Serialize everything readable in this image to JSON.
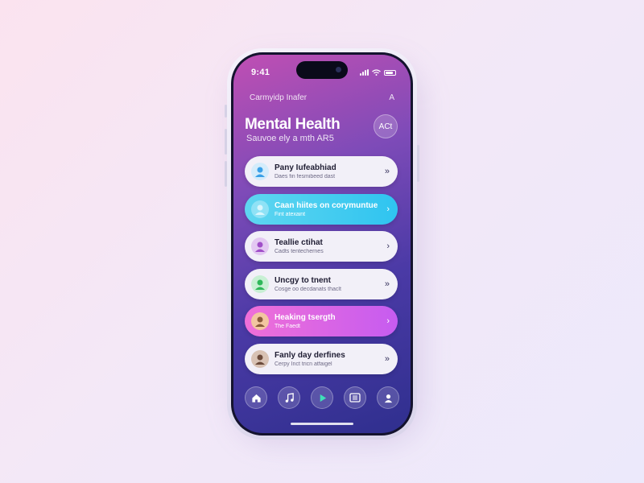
{
  "status_bar": {
    "time": "9:41"
  },
  "app": {
    "left_label": "Carmyidp Inafer",
    "right_label": "A",
    "title": "Mental Health",
    "subtitle": "Sauvoe ely a mth AR5",
    "action_label": "ACt"
  },
  "cards": [
    {
      "title": "Pany Iufeabhiad",
      "subtitle": "Daes fin fesmibeed dast",
      "style": "light",
      "avatar_color": "#3aa0e8",
      "avatar_icon": "person-icon"
    },
    {
      "title": "Caan hiites on corymuntue",
      "subtitle": "Fint atexaint",
      "style": "teal",
      "avatar_color": "#8fe2f6",
      "avatar_icon": "person-icon"
    },
    {
      "title": "Teallie ctihat",
      "subtitle": "Cadts tentechernes",
      "style": "light",
      "avatar_color": "#a04fc8",
      "avatar_icon": "person-icon"
    },
    {
      "title": "Uncgy to tnent",
      "subtitle": "Cosge oo decdanats thaclt",
      "style": "light",
      "avatar_color": "#2fb85a",
      "avatar_icon": "person-icon"
    },
    {
      "title": "Heaking tsergth",
      "subtitle": "The Faedt",
      "style": "pink",
      "avatar_color": "#f2c6a0",
      "avatar_icon": "person-icon"
    },
    {
      "title": "Fanly day derfines",
      "subtitle": "Cerpy Inct tricn atfaigel",
      "style": "light",
      "avatar_color": "#6b4a3a",
      "avatar_icon": "person-icon"
    }
  ],
  "nav": [
    {
      "name": "home",
      "icon": "home-icon"
    },
    {
      "name": "music",
      "icon": "music-note-icon"
    },
    {
      "name": "play",
      "icon": "play-icon",
      "accent": "#3fe0b8"
    },
    {
      "name": "media",
      "icon": "grid-icon"
    },
    {
      "name": "profile",
      "icon": "user-icon"
    }
  ]
}
